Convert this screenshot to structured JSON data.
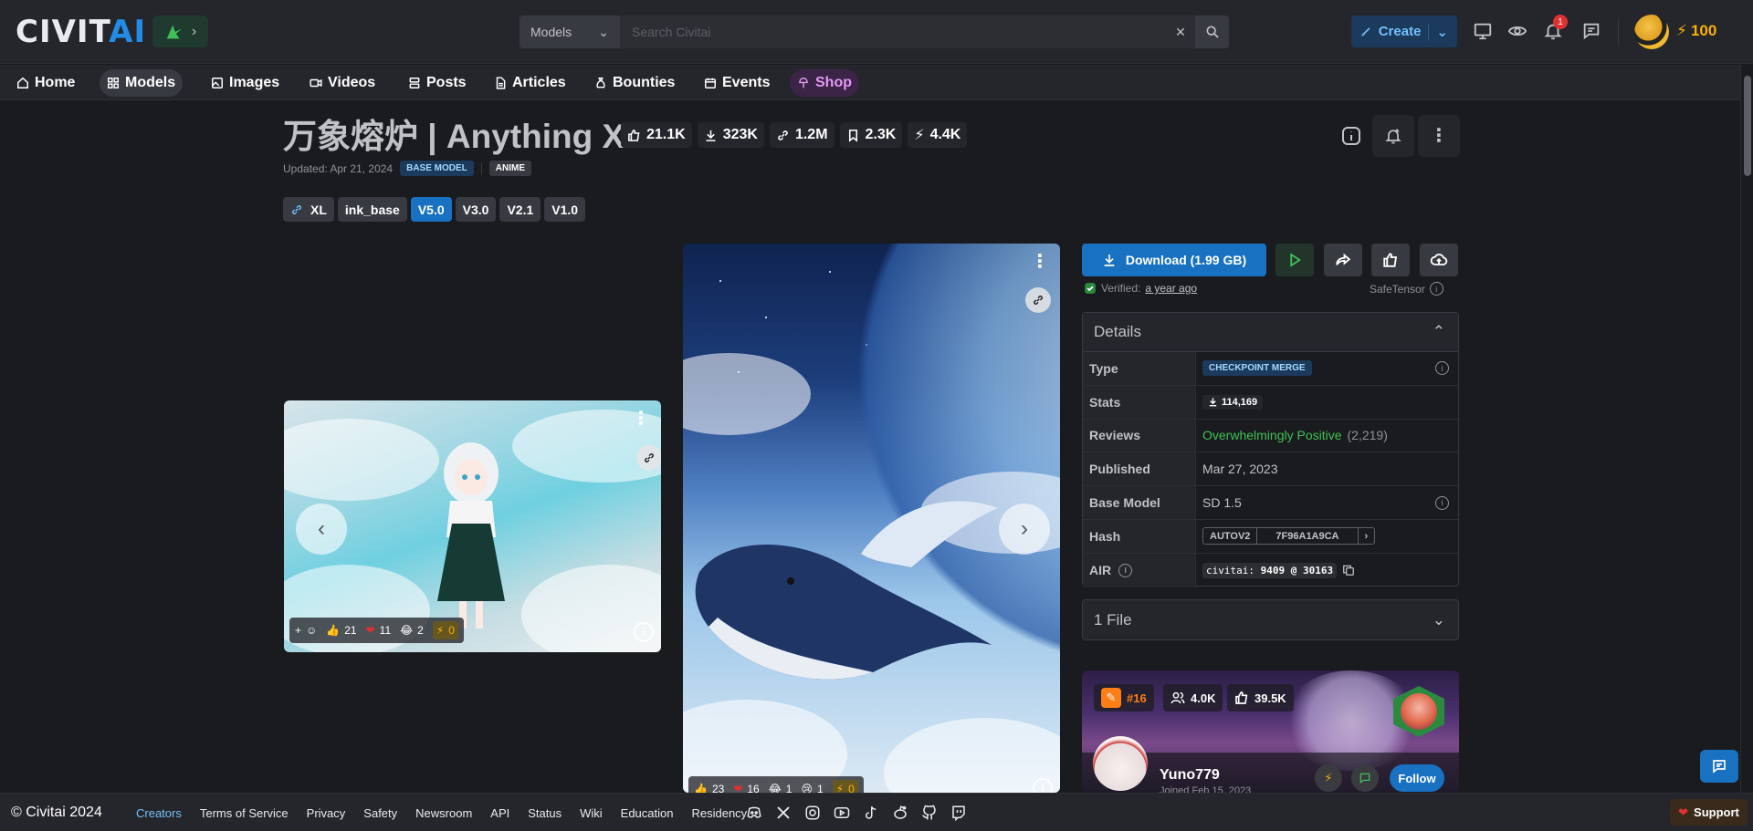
{
  "header": {
    "logo_main": "CIVIT",
    "logo_accent": "AI",
    "search_category": "Models",
    "search_placeholder": "Search Civitai",
    "create_label": "Create",
    "notification_count": "1",
    "buzz_amount": "100"
  },
  "nav": {
    "items": [
      {
        "label": "Home",
        "icon": "home-icon"
      },
      {
        "label": "Models",
        "icon": "grid-icon"
      },
      {
        "label": "Images",
        "icon": "photo-icon"
      },
      {
        "label": "Videos",
        "icon": "video-icon"
      },
      {
        "label": "Posts",
        "icon": "posts-icon"
      },
      {
        "label": "Articles",
        "icon": "file-icon"
      },
      {
        "label": "Bounties",
        "icon": "moneybag-icon"
      },
      {
        "label": "Events",
        "icon": "calendar-icon"
      },
      {
        "label": "Shop",
        "icon": "shop-icon"
      }
    ],
    "active": "Models"
  },
  "model": {
    "title": "万象熔炉 | Anything XL",
    "stats": {
      "likes": "21.1K",
      "downloads": "323K",
      "generations": "1.2M",
      "collected": "2.3K",
      "buzz": "4.4K"
    },
    "updated": "Updated: Apr 21, 2024",
    "badges": [
      "BASE MODEL",
      "ANIME"
    ],
    "versions": [
      "XL",
      "ink_base",
      "V5.0",
      "V3.0",
      "V2.1",
      "V1.0"
    ],
    "active_version": "V5.0"
  },
  "gallery": {
    "card1_reactions": {
      "like": "21",
      "heart": "11",
      "laugh": "2",
      "buzz": "0"
    },
    "card2_reactions": {
      "like": "23",
      "heart": "16",
      "laugh": "1",
      "cry": "1",
      "buzz": "0"
    },
    "info_glyph": "i"
  },
  "download": {
    "label": "Download (1.99 GB)",
    "verified_prefix": "Verified:",
    "verified_time": "a year ago",
    "format": "SafeTensor"
  },
  "details": {
    "heading": "Details",
    "rows": {
      "type_label": "Type",
      "type_value": "CHECKPOINT MERGE",
      "stats_label": "Stats",
      "stats_value": "114,169",
      "reviews_label": "Reviews",
      "reviews_value": "Overwhelmingly Positive",
      "reviews_count": "(2,219)",
      "published_label": "Published",
      "published_value": "Mar 27, 2023",
      "base_label": "Base Model",
      "base_value": "SD 1.5",
      "hash_label": "Hash",
      "hash_type": "AUTOV2",
      "hash_value": "7F96A1A9CA",
      "air_label": "AIR",
      "air_prefix": "civitai:",
      "air_value": "9409 @ 30163"
    }
  },
  "files": {
    "label": "1 File"
  },
  "creator": {
    "rank": "#16",
    "followers": "4.0K",
    "likes": "39.5K",
    "name": "Yuno779",
    "joined": "Joined Feb 15, 2023",
    "follow_label": "Follow"
  },
  "footer": {
    "copyright": "© Civitai 2024",
    "links": [
      "Creators",
      "Terms of Service",
      "Privacy",
      "Safety",
      "Newsroom",
      "API",
      "Status",
      "Wiki",
      "Education",
      "Residency"
    ],
    "support_label": "Support"
  },
  "colors": {
    "accent": "#1971c2",
    "background": "#1a1b1e",
    "panel": "#25262b",
    "positive": "#40c057",
    "buzz": "#fab005"
  }
}
